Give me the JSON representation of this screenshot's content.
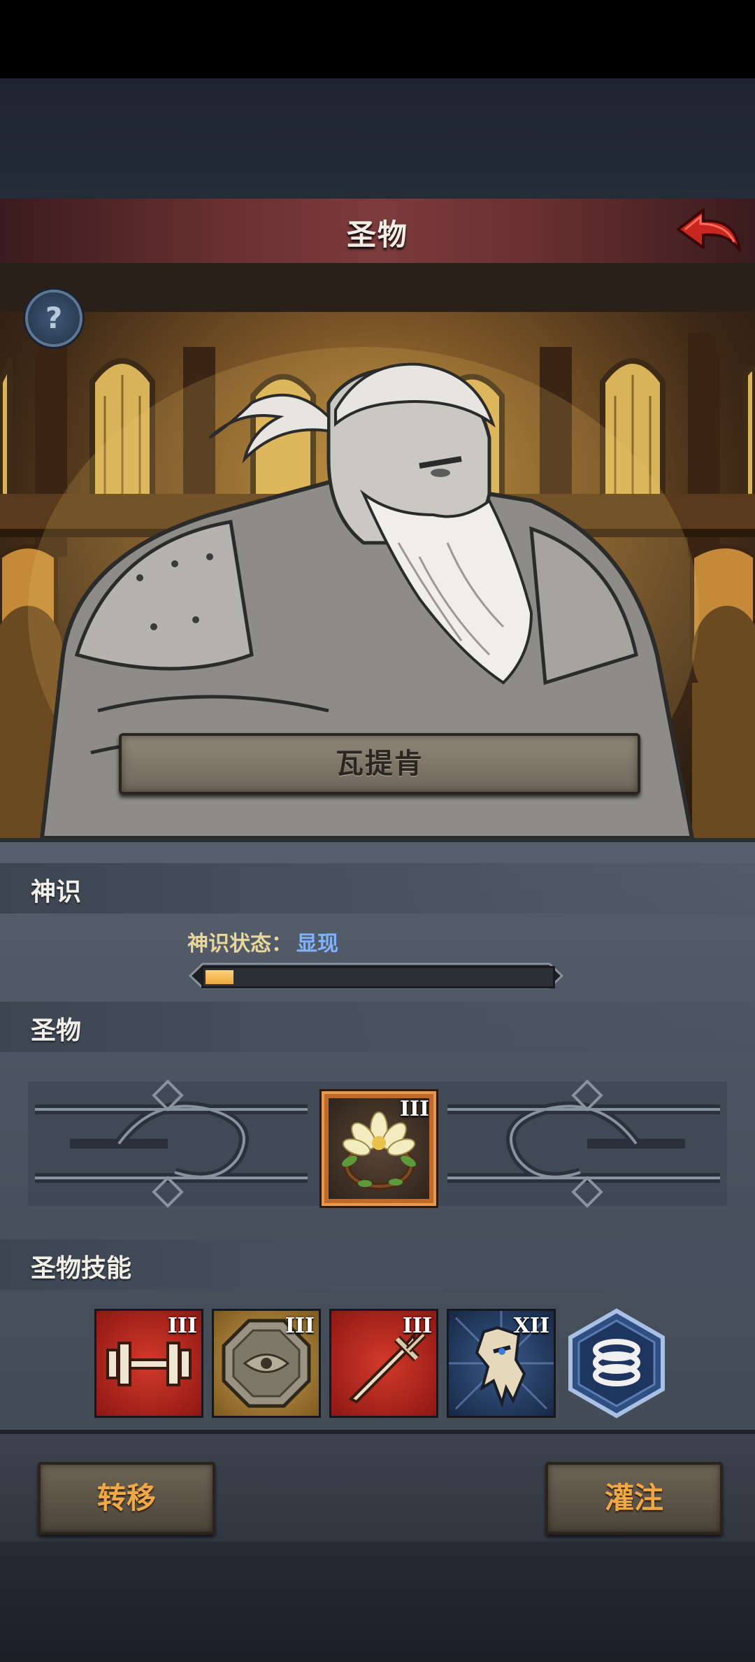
{
  "header": {
    "title": "圣物",
    "back_icon": "back-arrow-icon"
  },
  "hero": {
    "name": "瓦提肯",
    "help_label": "?"
  },
  "divine_sense": {
    "section_title": "神识",
    "status_label": "神识状态：",
    "status_value": "显现",
    "progress": 0.08
  },
  "relic": {
    "section_title": "圣物",
    "item": {
      "icon": "lotus-wreath-icon",
      "level": "III"
    }
  },
  "relic_skills": {
    "section_title": "圣物技能",
    "skills": [
      {
        "icon": "dumbbell-icon",
        "level": "III",
        "color": "#b42a1f"
      },
      {
        "icon": "octagon-medallion-icon",
        "level": "III",
        "color": "#a8822f"
      },
      {
        "icon": "sword-icon",
        "level": "III",
        "color": "#b42a1f"
      },
      {
        "icon": "ornate-mask-icon",
        "level": "XII",
        "color": "#26406a"
      },
      {
        "icon": "spring-coil-icon",
        "level": "",
        "color": "#2f4f82"
      }
    ]
  },
  "actions": {
    "transfer_label": "转移",
    "infuse_label": "灌注"
  },
  "colors": {
    "accent_orange": "#f0a746",
    "status_blue": "#7fb2ff",
    "banner_red": "#7c3b3c"
  }
}
